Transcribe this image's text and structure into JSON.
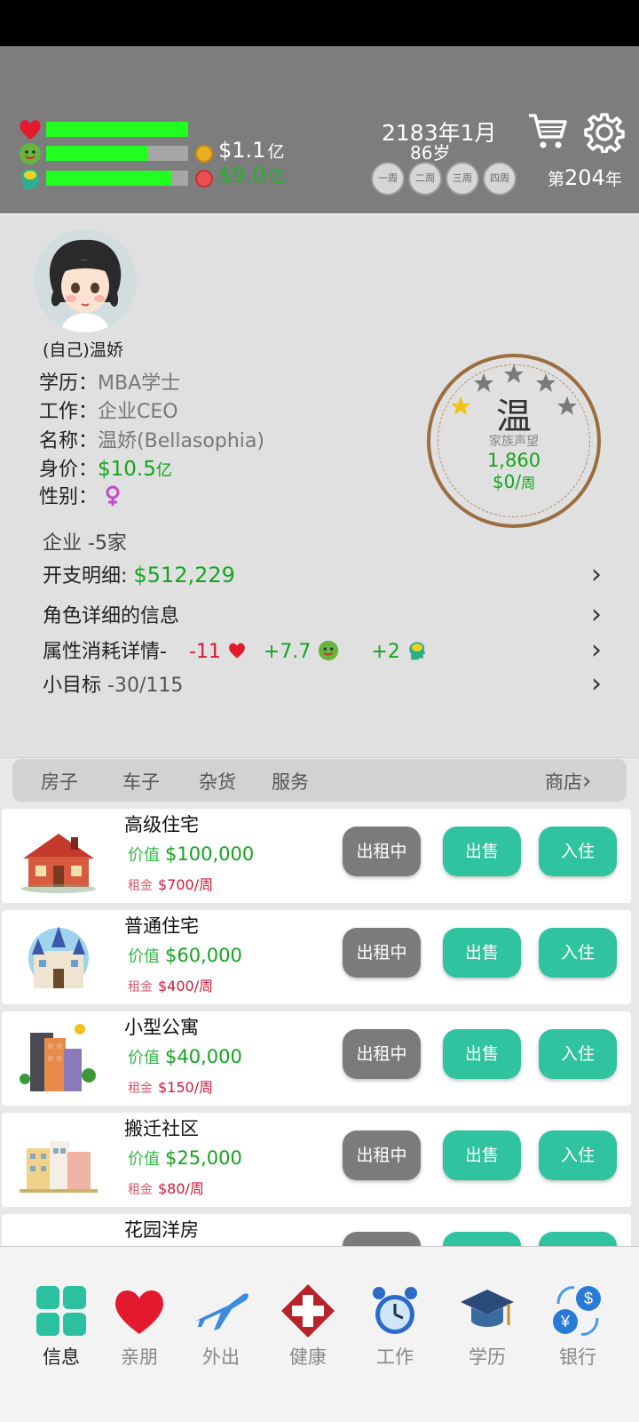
{
  "header": {
    "money1": "$1.1",
    "money1_unit": "亿",
    "money2": "$9.0",
    "money2_unit": "亿",
    "bars": [
      {
        "icon": "heart-icon",
        "level": 1.0
      },
      {
        "icon": "face-icon",
        "level": 0.72
      },
      {
        "icon": "brain-icon",
        "level": 0.88
      }
    ],
    "date": "2183年1月",
    "age": "86岁",
    "weeks": [
      "一周",
      "二周",
      "三周",
      "四周"
    ],
    "year_prefix": "第",
    "year_value": "204",
    "year_suffix": "年"
  },
  "profile": {
    "name_label": "(自己)温娇",
    "education_label": "学历：",
    "education_value": "MBA学士",
    "job_label": "工作：",
    "job_value": "企业CEO",
    "title_label": "名称：",
    "title_value": "温娇(Bellasophia)",
    "worth_label": "身价：",
    "worth_value": "$10.5",
    "worth_unit": "亿",
    "gender_label": "性别：",
    "gender_icon": "female-icon",
    "enterprise": "企业 -5家",
    "expense_label": "开支明细:",
    "expense_value": "$512,229",
    "details_label": "角色详细的信息",
    "attr_label": "属性消耗详情-",
    "attr_health": "-11",
    "attr_mood": "+7.7",
    "attr_mind": "+2",
    "goal_label": "小目标",
    "goal_value": "-30/115"
  },
  "seal": {
    "char": "温",
    "label": "家族声望",
    "reputation": "1,860",
    "income": "$0/",
    "income_unit": "周",
    "stars": [
      true,
      false,
      false,
      false,
      false
    ]
  },
  "tabs": [
    "房子",
    "车子",
    "杂货",
    "服务"
  ],
  "shop_label": "商店",
  "properties": [
    {
      "name": "高级住宅",
      "value_label": "价值",
      "value": "$100,000",
      "rent_label": "租金",
      "rent": "$700/周",
      "status": "出租中",
      "sell": "出售",
      "move_in": "入住"
    },
    {
      "name": "普通住宅",
      "value_label": "价值",
      "value": "$60,000",
      "rent_label": "租金",
      "rent": "$400/周",
      "status": "出租中",
      "sell": "出售",
      "move_in": "入住"
    },
    {
      "name": "小型公寓",
      "value_label": "价值",
      "value": "$40,000",
      "rent_label": "租金",
      "rent": "$150/周",
      "status": "出租中",
      "sell": "出售",
      "move_in": "入住"
    },
    {
      "name": "搬迁社区",
      "value_label": "价值",
      "value": "$25,000",
      "rent_label": "租金",
      "rent": "$80/周",
      "status": "出租中",
      "sell": "出售",
      "move_in": "入住"
    },
    {
      "name": "花园洋房"
    }
  ],
  "nav": [
    {
      "label": "信息",
      "icon": "info-grid-icon"
    },
    {
      "label": "亲朋",
      "icon": "heart-icon"
    },
    {
      "label": "外出",
      "icon": "airplane-icon"
    },
    {
      "label": "健康",
      "icon": "medical-cross-icon"
    },
    {
      "label": "工作",
      "icon": "alarm-clock-icon"
    },
    {
      "label": "学历",
      "icon": "graduation-cap-icon"
    },
    {
      "label": "银行",
      "icon": "currency-exchange-icon"
    }
  ],
  "colors": {
    "accent_teal": "#2fc3a0",
    "money_green": "#13a51e",
    "health_red": "#d11a3c"
  }
}
